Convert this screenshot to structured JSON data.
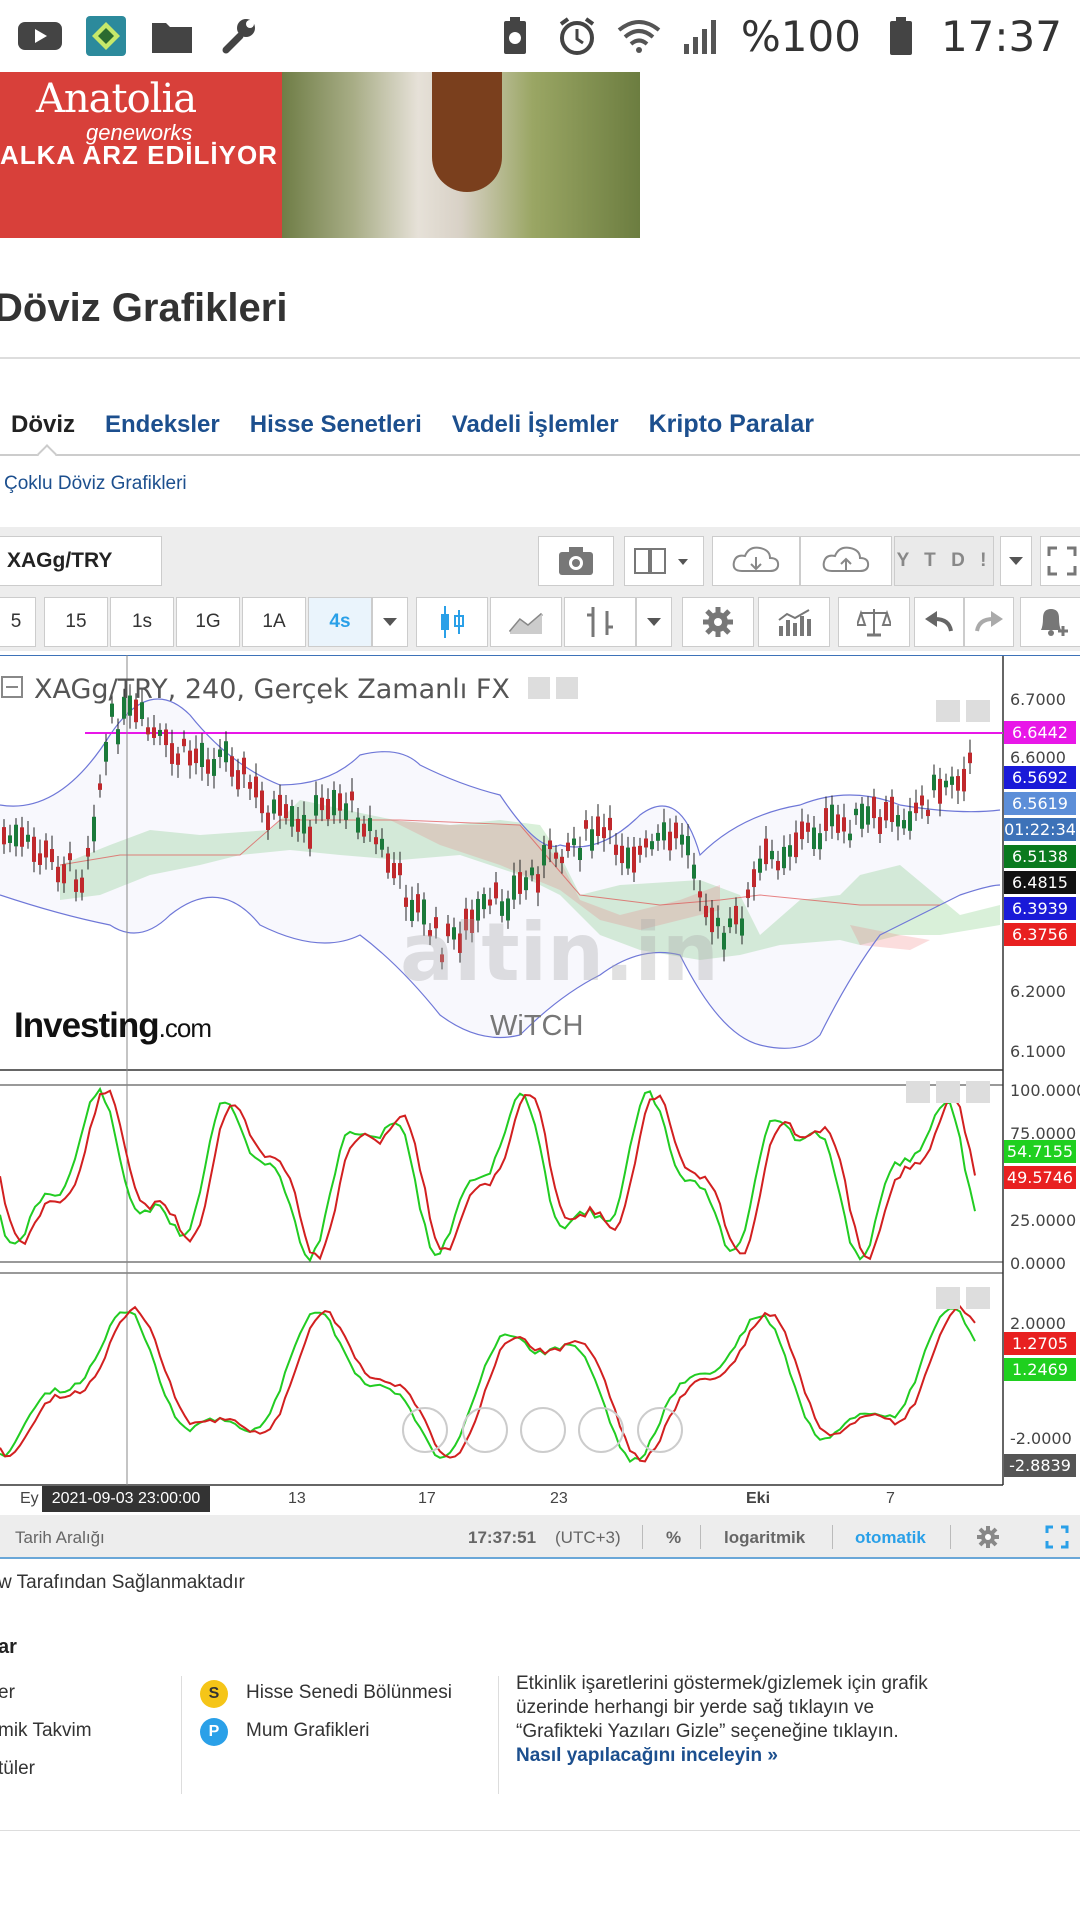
{
  "status_bar": {
    "battery": "%100",
    "time": "17:37",
    "left_icons": [
      "youtube-icon",
      "store-icon",
      "folder-icon",
      "wrench-icon"
    ],
    "right_icons": [
      "battery-saver-icon",
      "alarm-icon",
      "wifi-icon",
      "signal-icon",
      "battery-icon"
    ]
  },
  "ad": {
    "brand": "Anatolia",
    "brand_sub": "geneworks",
    "line": "ALKA ARZ EDİLİYOR"
  },
  "page": {
    "title": "Döviz Grafikleri",
    "subnav_link": "Çoklu Döviz Grafikleri"
  },
  "tabs": [
    {
      "label": "Döviz",
      "active": true
    },
    {
      "label": "Endeksler",
      "active": false
    },
    {
      "label": "Hisse Senetleri",
      "active": false
    },
    {
      "label": "Vadeli İşlemler",
      "active": false
    },
    {
      "label": "Kripto Paralar",
      "active": false
    }
  ],
  "toolbar": {
    "symbol": "XAGg/TRY",
    "ytd_label": "Y T D !",
    "timeframes": [
      "5",
      "15",
      "1s",
      "1G",
      "1A",
      "4s"
    ],
    "selected_timeframe": "4s"
  },
  "chart": {
    "title": "XAGg/TRY, 240, Gerçek Zamanlı FX",
    "brand": "Investing",
    "brand_suffix": ".com",
    "watermark": "altin.in",
    "watermark_sub": "WiTCH",
    "crosshair_date": "2021-09-03 23:00:00",
    "x_ticks": [
      "Ey",
      "13",
      "17",
      "23",
      "Eki",
      "7"
    ],
    "price_axis": [
      "6.7000",
      "6.6000",
      "6.2000",
      "6.1000"
    ],
    "price_labels": [
      {
        "value": "6.6442",
        "color": "#e817e8"
      },
      {
        "value": "6.5692",
        "color": "#1a1ad8"
      },
      {
        "value": "6.5619",
        "color": "#5c8ed8"
      },
      {
        "value": "01:22:34",
        "color": "#3d72b8"
      },
      {
        "value": "6.5138",
        "color": "#0a7a1e"
      },
      {
        "value": "6.4815",
        "color": "#111111"
      },
      {
        "value": "6.3939",
        "color": "#1a1ad8"
      },
      {
        "value": "6.3756",
        "color": "#e82020"
      }
    ],
    "stoch_axis": [
      "100.0000",
      "75.0000",
      "25.0000",
      "0.0000"
    ],
    "stoch_labels": [
      {
        "value": "54.7155",
        "color": "#1fd01f"
      },
      {
        "value": "49.5746",
        "color": "#e82020"
      }
    ],
    "osc_axis": [
      "2.0000",
      "-2.0000"
    ],
    "osc_labels": [
      {
        "value": "1.2705",
        "color": "#e82020"
      },
      {
        "value": "1.2469",
        "color": "#1fd01f"
      },
      {
        "value": "-2.8839",
        "color": "#555555"
      }
    ]
  },
  "bottom_bar": {
    "range_label": "Tarih Aralığı",
    "clock": "17:37:51",
    "tz": "(UTC+3)",
    "percent": "%",
    "log": "logaritmik",
    "auto": "otomatik"
  },
  "footer": {
    "provided_by": "w Tarafından Sağlanmaktadır",
    "legend_heading": "ar",
    "legend_left": [
      "er",
      "mik Takvim",
      "tüler"
    ],
    "legend_mid": [
      {
        "badge": "S",
        "label": "Hisse Senedi Bölünmesi",
        "color": "#f5c518"
      },
      {
        "badge": "P",
        "label": "Mum Grafikleri",
        "color": "#2aa0e8"
      }
    ],
    "hint": "Etkinlik işaretlerini göstermek/gizlemek için grafik üzerinde herhangi bir yerde sağ tıklayın ve “Grafikteki Yazıları Gizle” seçeneğine tıklayın.",
    "hint_link": "Nasıl yapılacağını inceleyin »"
  }
}
